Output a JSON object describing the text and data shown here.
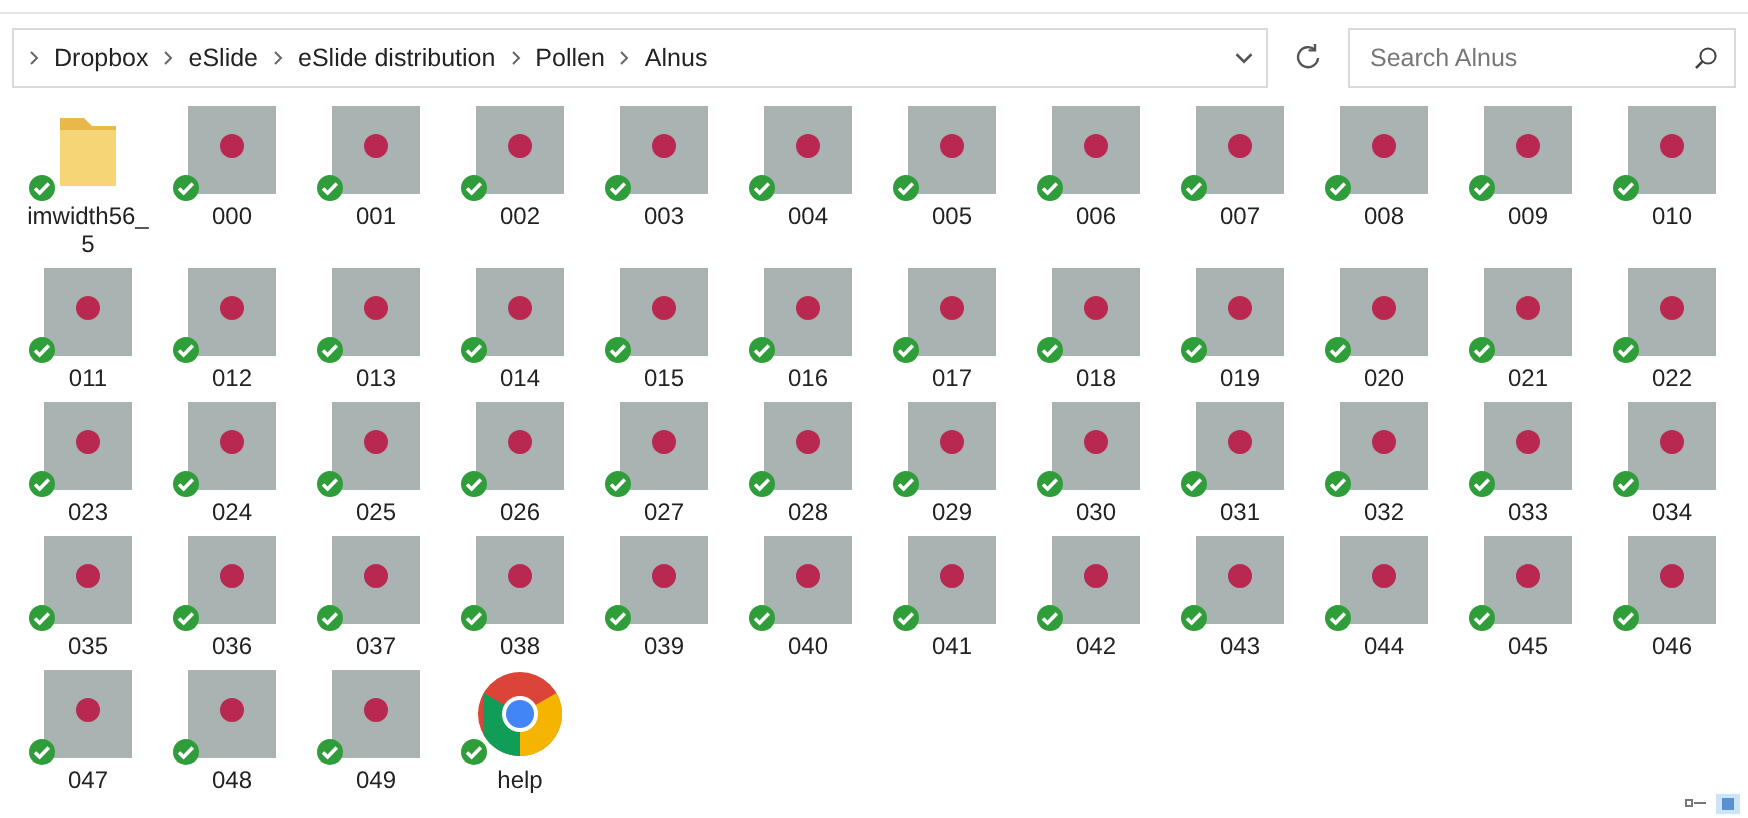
{
  "address_bar": {
    "path": [
      "Dropbox",
      "eSlide",
      "eSlide distribution",
      "Pollen",
      "Alnus"
    ]
  },
  "search": {
    "placeholder": "Search Alnus"
  },
  "items": [
    {
      "kind": "folder",
      "name": "imwidth56_5"
    },
    {
      "kind": "image",
      "name": "000"
    },
    {
      "kind": "image",
      "name": "001"
    },
    {
      "kind": "image",
      "name": "002"
    },
    {
      "kind": "image",
      "name": "003"
    },
    {
      "kind": "image",
      "name": "004"
    },
    {
      "kind": "image",
      "name": "005"
    },
    {
      "kind": "image",
      "name": "006"
    },
    {
      "kind": "image",
      "name": "007"
    },
    {
      "kind": "image",
      "name": "008"
    },
    {
      "kind": "image",
      "name": "009"
    },
    {
      "kind": "image",
      "name": "010"
    },
    {
      "kind": "image",
      "name": "011"
    },
    {
      "kind": "image",
      "name": "012"
    },
    {
      "kind": "image",
      "name": "013"
    },
    {
      "kind": "image",
      "name": "014"
    },
    {
      "kind": "image",
      "name": "015"
    },
    {
      "kind": "image",
      "name": "016"
    },
    {
      "kind": "image",
      "name": "017"
    },
    {
      "kind": "image",
      "name": "018"
    },
    {
      "kind": "image",
      "name": "019"
    },
    {
      "kind": "image",
      "name": "020"
    },
    {
      "kind": "image",
      "name": "021"
    },
    {
      "kind": "image",
      "name": "022"
    },
    {
      "kind": "image",
      "name": "023"
    },
    {
      "kind": "image",
      "name": "024"
    },
    {
      "kind": "image",
      "name": "025"
    },
    {
      "kind": "image",
      "name": "026"
    },
    {
      "kind": "image",
      "name": "027"
    },
    {
      "kind": "image",
      "name": "028"
    },
    {
      "kind": "image",
      "name": "029"
    },
    {
      "kind": "image",
      "name": "030"
    },
    {
      "kind": "image",
      "name": "031"
    },
    {
      "kind": "image",
      "name": "032"
    },
    {
      "kind": "image",
      "name": "033"
    },
    {
      "kind": "image",
      "name": "034"
    },
    {
      "kind": "image",
      "name": "035"
    },
    {
      "kind": "image",
      "name": "036"
    },
    {
      "kind": "image",
      "name": "037"
    },
    {
      "kind": "image",
      "name": "038"
    },
    {
      "kind": "image",
      "name": "039"
    },
    {
      "kind": "image",
      "name": "040"
    },
    {
      "kind": "image",
      "name": "041"
    },
    {
      "kind": "image",
      "name": "042"
    },
    {
      "kind": "image",
      "name": "043"
    },
    {
      "kind": "image",
      "name": "044"
    },
    {
      "kind": "image",
      "name": "045"
    },
    {
      "kind": "image",
      "name": "046"
    },
    {
      "kind": "image",
      "name": "047"
    },
    {
      "kind": "image",
      "name": "048"
    },
    {
      "kind": "image",
      "name": "049"
    },
    {
      "kind": "web",
      "name": "help"
    }
  ],
  "view_buttons": [
    {
      "kind": "details",
      "selected": false
    },
    {
      "kind": "large_icons",
      "selected": true
    }
  ]
}
